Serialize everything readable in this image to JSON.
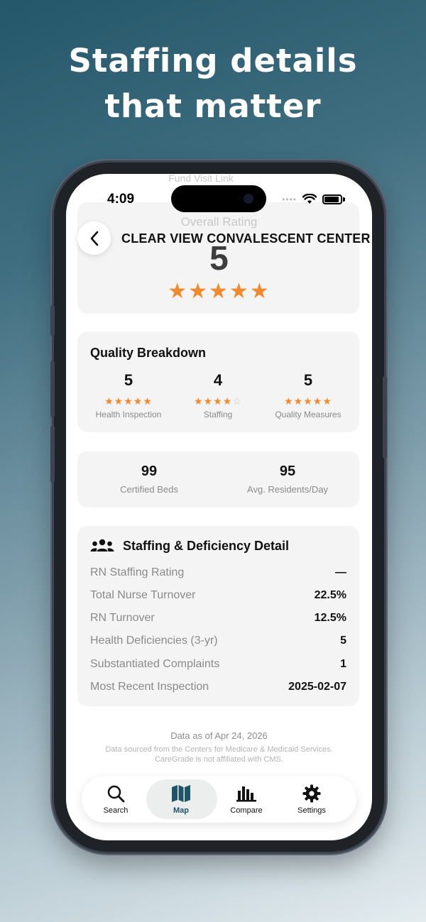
{
  "headline": {
    "line1": "Staffing details",
    "line2": "that matter"
  },
  "status_bar": {
    "time": "4:09",
    "dots": "••••"
  },
  "ghost": {
    "overall_rating_label": "Overall Rating",
    "top_text": "Fund Visit Link"
  },
  "facility": {
    "name": "CLEAR VIEW CONVALESCENT CENTER",
    "overall_rating": "5",
    "overall_stars": "★★★★★"
  },
  "quality_breakdown": {
    "title": "Quality Breakdown",
    "items": [
      {
        "value": "5",
        "stars": "★★★★★",
        "empty": "",
        "label": "Health Inspection"
      },
      {
        "value": "4",
        "stars": "★★★★",
        "empty": "☆",
        "label": "Staffing"
      },
      {
        "value": "5",
        "stars": "★★★★★",
        "empty": "",
        "label": "Quality Measures"
      }
    ]
  },
  "counts": [
    {
      "value": "99",
      "label": "Certified Beds"
    },
    {
      "value": "95",
      "label": "Avg. Residents/Day"
    }
  ],
  "staffing_detail": {
    "title": "Staffing & Deficiency Detail",
    "icon": "people-icon",
    "rows": [
      {
        "label": "RN Staffing Rating",
        "value": "—"
      },
      {
        "label": "Total Nurse Turnover",
        "value": "22.5%"
      },
      {
        "label": "RN Turnover",
        "value": "12.5%"
      },
      {
        "label": "Health Deficiencies (3-yr)",
        "value": "5"
      },
      {
        "label": "Substantiated Complaints",
        "value": "1"
      },
      {
        "label": "Most Recent Inspection",
        "value": "2025-02-07"
      }
    ]
  },
  "footer": {
    "data_as_of": "Data as of Apr 24, 2026",
    "source_line1": "Data sourced from the Centers for Medicare & Medicaid Services.",
    "source_line2": "CareGrade is not affiliated with CMS."
  },
  "tabs": [
    {
      "label": "Search",
      "icon": "search-icon"
    },
    {
      "label": "Map",
      "icon": "map-icon",
      "active": true
    },
    {
      "label": "Compare",
      "icon": "compare-chart-icon"
    },
    {
      "label": "Settings",
      "icon": "gear-icon"
    }
  ],
  "colors": {
    "star": "#f08a2c",
    "active_tab": "#1e5566",
    "card_bg": "#f4f4f4"
  }
}
